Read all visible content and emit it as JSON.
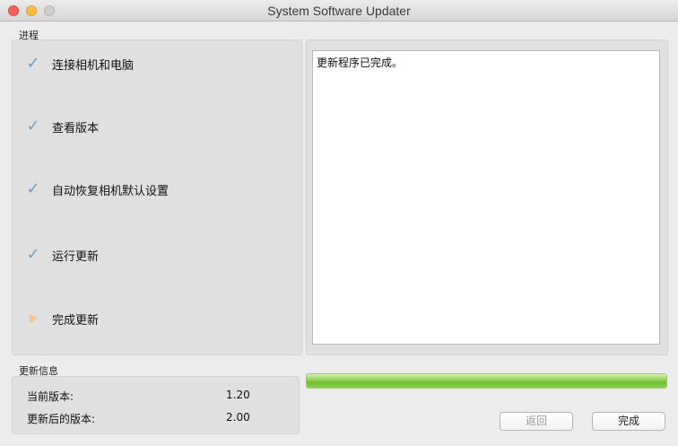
{
  "window": {
    "title": "System Software Updater"
  },
  "progress_section": {
    "label": "进程"
  },
  "steps": [
    {
      "label": "连接相机和电脑",
      "status": "done",
      "icon": "checkmark-icon"
    },
    {
      "label": "查看版本",
      "status": "done",
      "icon": "checkmark-icon"
    },
    {
      "label": "自动恢复相机默认设置",
      "status": "done",
      "icon": "checkmark-icon"
    },
    {
      "label": "运行更新",
      "status": "done",
      "icon": "checkmark-icon"
    },
    {
      "label": "完成更新",
      "status": "current",
      "icon": "arrow-right-icon"
    }
  ],
  "log": {
    "text": "更新程序已完成。"
  },
  "info_section": {
    "label": "更新信息",
    "current_version_label": "当前版本:",
    "current_version_value": "1.20",
    "new_version_label": "更新后的版本:",
    "new_version_value": "2.00"
  },
  "progress_bar": {
    "fraction": 1.0,
    "color": "#7cc63f"
  },
  "buttons": {
    "back_label": "返回",
    "done_label": "完成"
  },
  "colors": {
    "check": "#6fa0c2",
    "current_arrow": "#f3c38e"
  }
}
